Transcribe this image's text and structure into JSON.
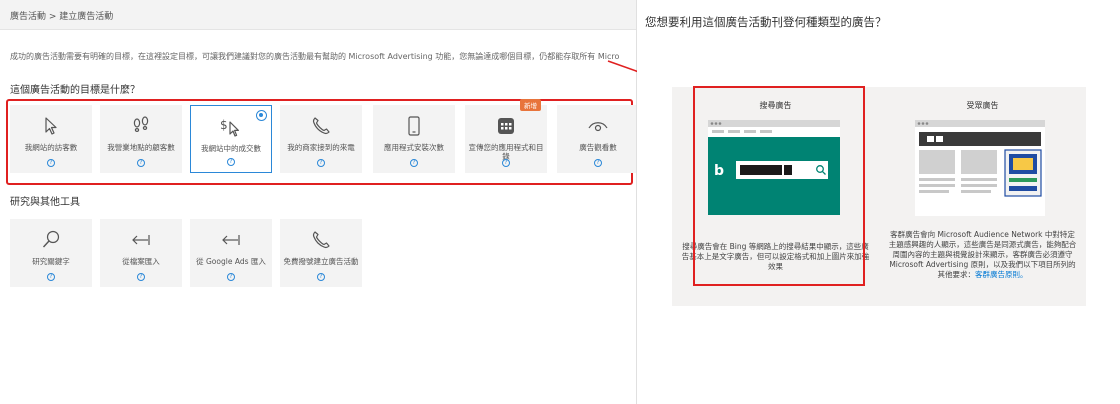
{
  "breadcrumb": "廣告活動 > 建立廣告活動",
  "intro_text": "成功的廣告活動需要有明確的目標，在這裡設定目標，可讓我們建議對您的廣告活動最有幫助的 Microsoft Advertising 功能，您無論達成哪個目標，仍都能存取所有 Micro",
  "goals_title": "這個廣告活動的目標是什麼？",
  "goals": [
    {
      "label": "我網站的訪客數",
      "icon": "cursor-icon"
    },
    {
      "label": "我營業地點的顧客數",
      "icon": "footprints-icon"
    },
    {
      "label": "我網站中的成交數",
      "icon": "dollar-cursor-icon",
      "selected": true
    },
    {
      "label": "我的商家接到的來電",
      "icon": "phone-icon"
    },
    {
      "label": "應用程式安裝次數",
      "icon": "smartphone-icon"
    },
    {
      "label": "宣傳您的應用程式和目錄",
      "icon": "catalog-icon",
      "badge": "新增"
    },
    {
      "label": "廣告觀看數",
      "icon": "eye-icon"
    }
  ],
  "tools_title": "研究與其他工具",
  "tools": [
    {
      "label": "研究關鍵字",
      "icon": "search-icon"
    },
    {
      "label": "從檔案匯入",
      "icon": "import-arrow-icon"
    },
    {
      "label": "從 Google Ads 匯入",
      "icon": "import-arrow-icon"
    },
    {
      "label": "免費撥號建立廣告活動",
      "icon": "phone-icon"
    }
  ],
  "help_glyph": "?",
  "right": {
    "title": "您想要利用這個廣告活動刊登何種類型的廣告？",
    "search_ads": {
      "title": "搜尋廣告",
      "description": "搜尋廣告會在 Bing 等網路上的搜尋結果中顯示，這些廣告基本上是文字廣告，但可以設定格式和加上圖片來加強效果"
    },
    "audience_ads": {
      "title": "受眾廣告",
      "description": "客群廣告會向 Microsoft Audience Network 中對特定主題感興趣的人顯示，這些廣告是同源式廣告，能夠配合周圍內容的主題與視覺設計來顯示，客群廣告必須遵守 Microsoft Advertising 原則，以及我們以下項目所列的其他要求：",
      "link": "客群廣告原則。"
    }
  },
  "colors": {
    "accent": "#2b88d8",
    "highlight": "#e02020",
    "bing_green": "#008373",
    "badge": "#e8743b"
  }
}
